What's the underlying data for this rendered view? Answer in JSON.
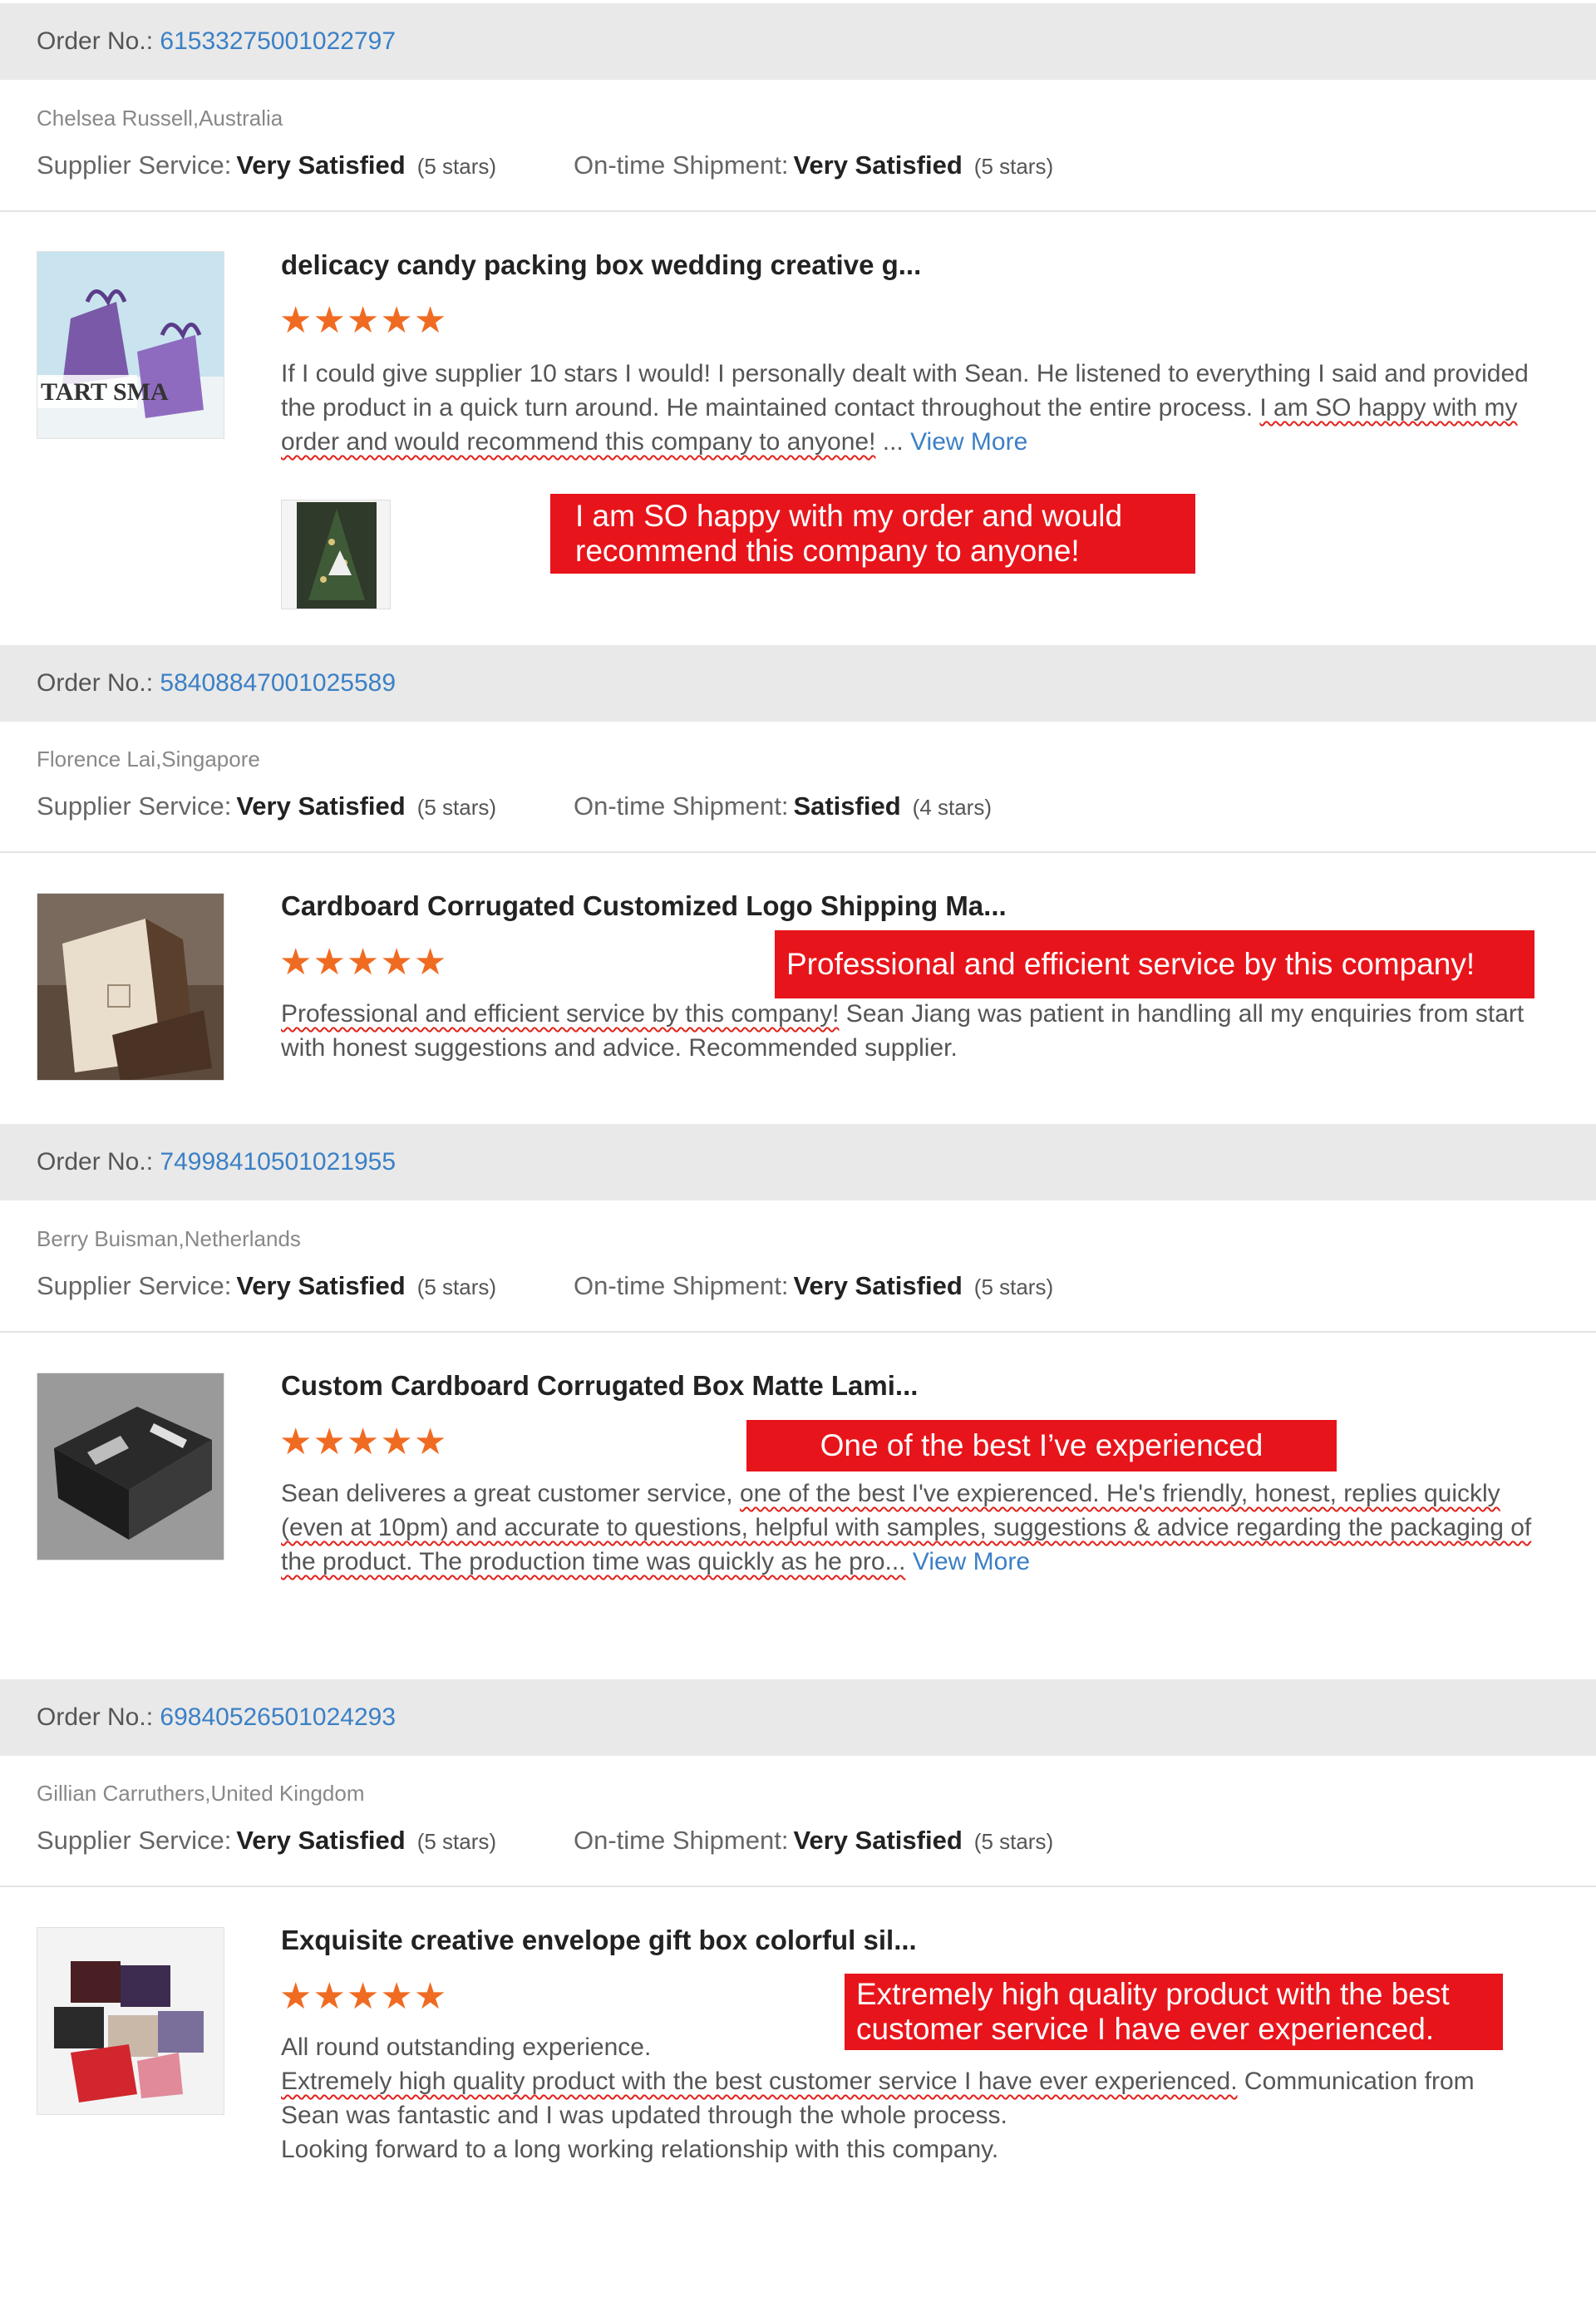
{
  "labels": {
    "order_prefix": "Order No.:",
    "supplier_service": "Supplier Service:",
    "ontime_shipment": "On-time Shipment:",
    "view_more": "View More"
  },
  "colors": {
    "order_link": "#3b80c6",
    "stars": "#f06b22",
    "callout_bg": "#e8141b",
    "header_bar": "#e9e9e9"
  },
  "orders": [
    {
      "order_number": "61533275001022797",
      "reviewer": "Chelsea Russell,Australia",
      "supplier_service": {
        "rating": "Very Satisfied",
        "stars_text": "(5 stars)",
        "stars": 5
      },
      "ontime_shipment": {
        "rating": "Very Satisfied",
        "stars_text": "(5 stars)",
        "stars": 5
      },
      "product_title": "delicacy candy packing box wedding creative g...",
      "product_stars": 5,
      "review_plain": "If I could give supplier 10 stars I would! I personally dealt with Sean. He listened to everything I said and provided the product in a quick turn around. He maintained contact throughout the entire process. ",
      "review_highlight": "I am SO happy with my order and would recommend this company to anyone!",
      "review_after": " ... ",
      "view_more": "View More",
      "callout": [
        "I am SO happy with my order and would",
        "recommend this company to anyone!"
      ],
      "thumb_icon": "product-photo-candy-box",
      "photo_icon": "review-photo-christmas-tree"
    },
    {
      "order_number": "58408847001025589",
      "reviewer": "Florence Lai,Singapore",
      "supplier_service": {
        "rating": "Very Satisfied",
        "stars_text": "(5 stars)",
        "stars": 5
      },
      "ontime_shipment": {
        "rating": "Satisfied",
        "stars_text": "(4 stars)",
        "stars": 4
      },
      "product_title": "Cardboard Corrugated Customized Logo Shipping Ma...",
      "product_stars": 5,
      "review_highlight": "Professional and efficient service by this company!",
      "review_after": " Sean Jiang was patient in handling all my enquiries from start with honest suggestions and advice. Recommended supplier.",
      "callout": [
        "Professional and efficient service by this company!"
      ],
      "thumb_icon": "product-photo-kraft-box"
    },
    {
      "order_number": "74998410501021955",
      "reviewer": "Berry Buisman,Netherlands",
      "supplier_service": {
        "rating": "Very Satisfied",
        "stars_text": "(5 stars)",
        "stars": 5
      },
      "ontime_shipment": {
        "rating": "Very Satisfied",
        "stars_text": "(5 stars)",
        "stars": 5
      },
      "product_title": "Custom Cardboard Corrugated Box Matte Lami...",
      "product_stars": 5,
      "review_plain": "Sean deliveres a great customer service, ",
      "review_highlight": "one of the best I've expierenced. He's friendly, honest, replies quickly (even at 10pm) and accurate to questions, helpful with samples, suggestions & advice regarding the packaging of the product. The production time was quickly as he pro...",
      "view_more": "View More",
      "callout": [
        "One of the best I’ve experienced"
      ],
      "thumb_icon": "product-photo-black-box"
    },
    {
      "order_number": "69840526501024293",
      "reviewer": "Gillian Carruthers,United Kingdom",
      "supplier_service": {
        "rating": "Very Satisfied",
        "stars_text": "(5 stars)",
        "stars": 5
      },
      "ontime_shipment": {
        "rating": "Very Satisfied",
        "stars_text": "(5 stars)",
        "stars": 5
      },
      "product_title": "Exquisite creative envelope gift box colorful sil...",
      "product_stars": 5,
      "review_line1": "All round outstanding experience.",
      "review_highlight": "Extremely high quality product with the best customer service I have ever experienced.",
      "review_after": " Communication from Sean was fantastic and I was updated through the whole process.",
      "review_line3": "Looking forward to a long working relationship with this company.",
      "callout": [
        "Extremely high quality product with the best",
        "customer service I have ever experienced."
      ],
      "thumb_icon": "product-photo-envelope-boxes"
    }
  ]
}
